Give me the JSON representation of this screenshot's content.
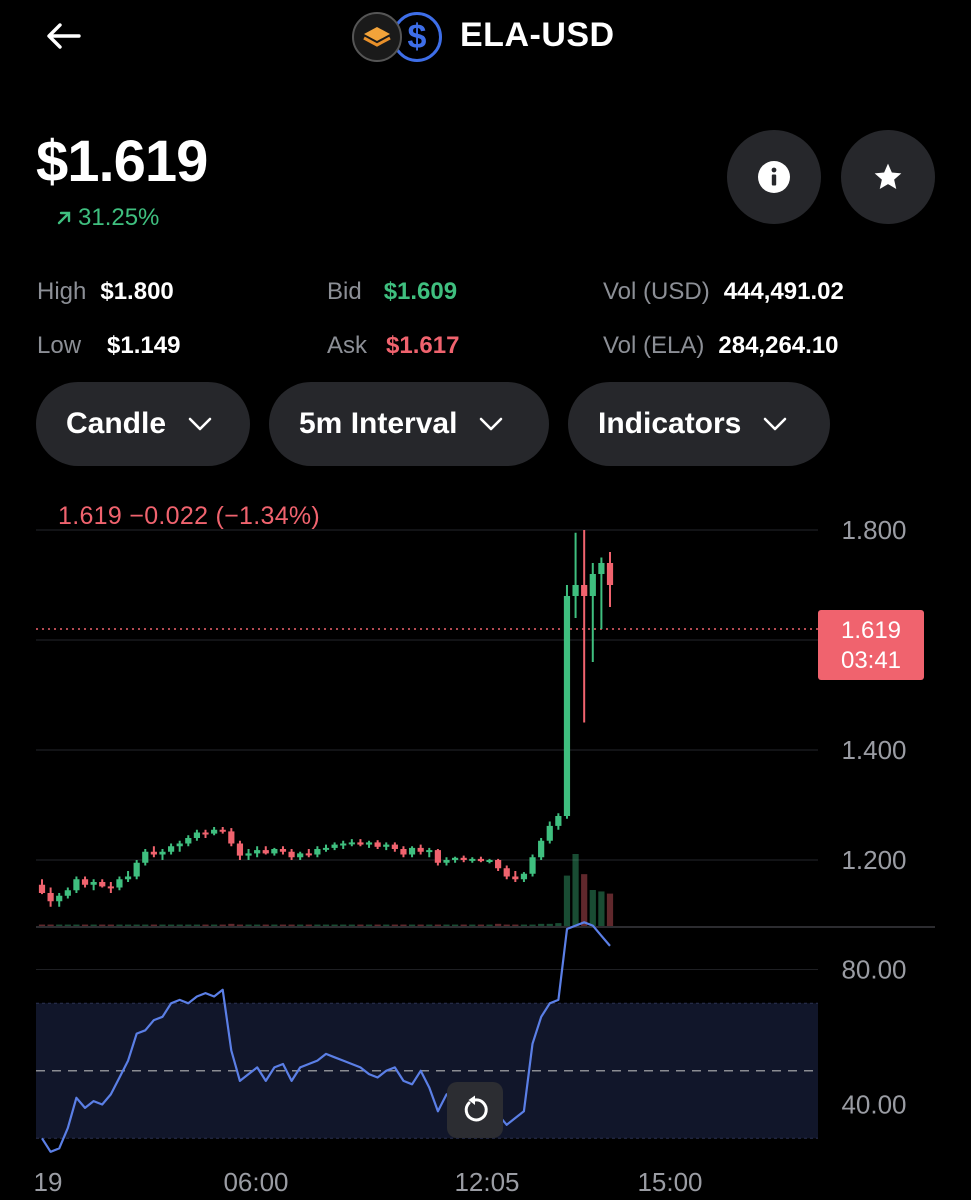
{
  "header": {
    "title": "ELA-USD",
    "base_icon": "ela-coin-icon",
    "quote_icon": "usd-coin-icon",
    "quote_symbol": "$"
  },
  "price": {
    "current": "$1.619",
    "change_pct": "31.25%"
  },
  "stats": {
    "high_label": "High",
    "high_value": "$1.800",
    "low_label": "Low",
    "low_value": "$1.149",
    "bid_label": "Bid",
    "bid_value": "$1.609",
    "ask_label": "Ask",
    "ask_value": "$1.617",
    "vol_usd_label": "Vol (USD)",
    "vol_usd_value": "444,491.02",
    "vol_ela_label": "Vol (ELA)",
    "vol_ela_value": "284,264.10"
  },
  "controls": {
    "chart_type": "Candle",
    "interval": "5m Interval",
    "indicators": "Indicators"
  },
  "chart": {
    "ohlc_label": "1.619  −0.022 (−1.34%)",
    "current_price_tag": "1.619",
    "countdown": "03:41",
    "price_axis": [
      "1.800",
      "1.400",
      "1.200"
    ],
    "rsi_axis": [
      "80.00",
      "40.00"
    ],
    "time_axis": [
      "19",
      "06:00",
      "12:05",
      "15:00"
    ]
  },
  "colors": {
    "up": "#3fbf7f",
    "down": "#f0636e",
    "rsi_line": "#5b7fe6",
    "background": "#000000",
    "button_bg": "#26272b"
  },
  "chart_data": {
    "type": "candlestick",
    "price_range": [
      1.0,
      1.8
    ],
    "candles": [
      [
        1.155,
        1.165,
        1.138,
        1.14
      ],
      [
        1.14,
        1.15,
        1.115,
        1.125
      ],
      [
        1.125,
        1.14,
        1.115,
        1.135
      ],
      [
        1.135,
        1.15,
        1.13,
        1.145
      ],
      [
        1.145,
        1.17,
        1.14,
        1.165
      ],
      [
        1.165,
        1.17,
        1.15,
        1.155
      ],
      [
        1.155,
        1.165,
        1.145,
        1.16
      ],
      [
        1.16,
        1.165,
        1.15,
        1.152
      ],
      [
        1.152,
        1.16,
        1.14,
        1.15
      ],
      [
        1.15,
        1.17,
        1.145,
        1.165
      ],
      [
        1.165,
        1.18,
        1.16,
        1.17
      ],
      [
        1.17,
        1.2,
        1.165,
        1.195
      ],
      [
        1.195,
        1.22,
        1.19,
        1.215
      ],
      [
        1.215,
        1.225,
        1.205,
        1.21
      ],
      [
        1.21,
        1.22,
        1.2,
        1.215
      ],
      [
        1.215,
        1.23,
        1.21,
        1.225
      ],
      [
        1.225,
        1.235,
        1.215,
        1.23
      ],
      [
        1.23,
        1.245,
        1.225,
        1.24
      ],
      [
        1.24,
        1.255,
        1.235,
        1.25
      ],
      [
        1.25,
        1.255,
        1.24,
        1.248
      ],
      [
        1.248,
        1.26,
        1.245,
        1.255
      ],
      [
        1.255,
        1.26,
        1.248,
        1.252
      ],
      [
        1.252,
        1.258,
        1.225,
        1.23
      ],
      [
        1.23,
        1.235,
        1.2,
        1.208
      ],
      [
        1.208,
        1.22,
        1.2,
        1.212
      ],
      [
        1.212,
        1.225,
        1.205,
        1.218
      ],
      [
        1.218,
        1.225,
        1.21,
        1.212
      ],
      [
        1.212,
        1.222,
        1.208,
        1.22
      ],
      [
        1.22,
        1.225,
        1.21,
        1.215
      ],
      [
        1.215,
        1.22,
        1.2,
        1.205
      ],
      [
        1.205,
        1.215,
        1.2,
        1.212
      ],
      [
        1.212,
        1.22,
        1.205,
        1.21
      ],
      [
        1.21,
        1.225,
        1.205,
        1.22
      ],
      [
        1.22,
        1.228,
        1.215,
        1.222
      ],
      [
        1.222,
        1.232,
        1.218,
        1.228
      ],
      [
        1.228,
        1.235,
        1.22,
        1.23
      ],
      [
        1.23,
        1.238,
        1.225,
        1.232
      ],
      [
        1.232,
        1.238,
        1.225,
        1.228
      ],
      [
        1.228,
        1.235,
        1.222,
        1.232
      ],
      [
        1.232,
        1.236,
        1.22,
        1.224
      ],
      [
        1.224,
        1.232,
        1.218,
        1.228
      ],
      [
        1.228,
        1.232,
        1.215,
        1.22
      ],
      [
        1.22,
        1.225,
        1.205,
        1.21
      ],
      [
        1.21,
        1.225,
        1.205,
        1.222
      ],
      [
        1.222,
        1.228,
        1.21,
        1.215
      ],
      [
        1.215,
        1.222,
        1.205,
        1.218
      ],
      [
        1.218,
        1.22,
        1.19,
        1.195
      ],
      [
        1.195,
        1.205,
        1.19,
        1.2
      ],
      [
        1.2,
        1.206,
        1.195,
        1.204
      ],
      [
        1.204,
        1.208,
        1.196,
        1.2
      ],
      [
        1.2,
        1.205,
        1.195,
        1.202
      ],
      [
        1.202,
        1.206,
        1.196,
        1.198
      ],
      [
        1.198,
        1.202,
        1.194,
        1.2
      ],
      [
        1.2,
        1.202,
        1.18,
        1.185
      ],
      [
        1.185,
        1.19,
        1.165,
        1.17
      ],
      [
        1.17,
        1.18,
        1.16,
        1.165
      ],
      [
        1.165,
        1.178,
        1.16,
        1.175
      ],
      [
        1.175,
        1.21,
        1.17,
        1.205
      ],
      [
        1.205,
        1.24,
        1.2,
        1.235
      ],
      [
        1.235,
        1.27,
        1.23,
        1.262
      ],
      [
        1.262,
        1.285,
        1.255,
        1.28
      ],
      [
        1.28,
        1.7,
        1.275,
        1.68
      ],
      [
        1.68,
        1.795,
        1.64,
        1.7
      ],
      [
        1.7,
        1.8,
        1.45,
        1.68
      ],
      [
        1.68,
        1.74,
        1.56,
        1.72
      ],
      [
        1.72,
        1.75,
        1.62,
        1.74
      ],
      [
        1.74,
        1.76,
        1.66,
        1.7
      ]
    ],
    "volume_scale": 100,
    "volumes": [
      2,
      2,
      2,
      2,
      2,
      2,
      2,
      2,
      2,
      2,
      2,
      2,
      2,
      2,
      2,
      2,
      2,
      2,
      2,
      2,
      2,
      2,
      3,
      2,
      2,
      2,
      2,
      2,
      2,
      2,
      2,
      2,
      2,
      2,
      2,
      2,
      2,
      2,
      2,
      2,
      2,
      2,
      2,
      2,
      2,
      2,
      2,
      2,
      2,
      2,
      2,
      2,
      2,
      3,
      2,
      2,
      2,
      2,
      3,
      3,
      4,
      70,
      100,
      72,
      50,
      48,
      45
    ],
    "rsi_range": [
      20,
      100
    ],
    "rsi": [
      30,
      26,
      27,
      33,
      42,
      39,
      41,
      40,
      43,
      48,
      53,
      61,
      62,
      65,
      66,
      70,
      71,
      70,
      72,
      73,
      72,
      74,
      56,
      47,
      49,
      51,
      47,
      51,
      52,
      47,
      51,
      52,
      53,
      55,
      54,
      53,
      52,
      51,
      49,
      48,
      50,
      51,
      47,
      46,
      50,
      45,
      38,
      43,
      44,
      45,
      45,
      44,
      43,
      37,
      34,
      36,
      38,
      58,
      66,
      70,
      71,
      92,
      93,
      94,
      93,
      90,
      87
    ],
    "rsi_band": [
      30,
      70
    ],
    "rsi_mid": 50
  }
}
